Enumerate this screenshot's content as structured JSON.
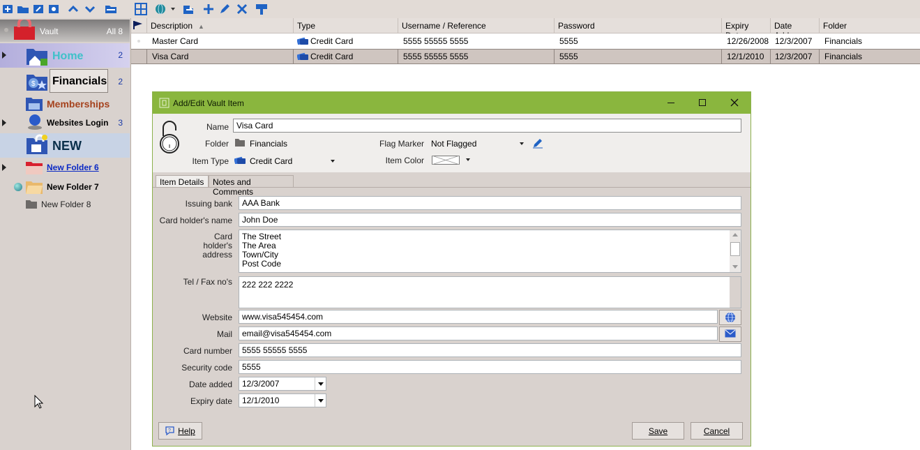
{
  "toolbar": {
    "left_icons": [
      "add-icon",
      "open-folder-icon",
      "edit-folder-icon",
      "settings-folder-icon",
      "move-up-icon",
      "move-down-icon",
      "folder-icon"
    ],
    "right_icons": [
      "grid-view-icon",
      "globe-icon",
      "dropdown-icon",
      "import-icon",
      "add-item-icon",
      "edit-item-icon",
      "delete-item-icon",
      "tree-icon"
    ]
  },
  "tree": {
    "root": {
      "label": "Vault",
      "count": "All 8"
    },
    "items": [
      {
        "label": "Home",
        "count": "2"
      },
      {
        "label": "Financials",
        "count": "2"
      },
      {
        "label": "Memberships",
        "count": ""
      },
      {
        "label": "Websites Login",
        "count": "3"
      },
      {
        "label": "NEW",
        "count": ""
      },
      {
        "label": "New Folder 6",
        "count": ""
      },
      {
        "label": "New Folder 7",
        "count": ""
      },
      {
        "label": "New Folder 8",
        "count": ""
      }
    ]
  },
  "grid": {
    "columns": [
      "Description",
      "Type",
      "Username / Reference",
      "Password",
      "Expiry Date",
      "Date Add...",
      "Folder"
    ],
    "rows": [
      {
        "description": "Master Card",
        "type": "Credit Card",
        "username": "5555 55555 5555",
        "password": "5555",
        "expiry": "12/26/2008",
        "added": "12/3/2007",
        "folder": "Financials"
      },
      {
        "description": "Visa Card",
        "type": "Credit Card",
        "username": "5555 55555 5555",
        "password": "5555",
        "expiry": "12/1/2010",
        "added": "12/3/2007",
        "folder": "Financials"
      }
    ]
  },
  "dialog": {
    "title": "Add/Edit Vault Item",
    "name_label": "Name",
    "name_value": "Visa Card",
    "folder_label": "Folder",
    "folder_value": "Financials",
    "item_type_label": "Item Type",
    "item_type_value": "Credit Card",
    "flag_label": "Flag Marker",
    "flag_value": "Not Flagged",
    "color_label": "Item Color",
    "tabs": [
      "Item Details",
      "Notes and Comments"
    ],
    "fields": {
      "issuing_bank": {
        "label": "Issuing bank",
        "value": "AAA Bank"
      },
      "holder_name": {
        "label": "Card holder's name",
        "value": "John Doe"
      },
      "holder_address": {
        "label1": "Card",
        "label2": "holder's",
        "label3": "address",
        "lines": [
          "The Street",
          "The Area",
          "Town/City",
          "Post Code"
        ]
      },
      "tel": {
        "label": "Tel / Fax no's",
        "value": "222 222 2222"
      },
      "website": {
        "label": "Website",
        "value": "www.visa545454.com"
      },
      "mail": {
        "label": "Mail",
        "value": "email@visa545454.com"
      },
      "card_number": {
        "label": "Card number",
        "value": "5555 55555 5555"
      },
      "security_code": {
        "label": "Security code",
        "value": "5555"
      },
      "date_added": {
        "label": "Date added",
        "value": "12/3/2007"
      },
      "expiry_date": {
        "label": "Expiry date",
        "value": "12/1/2010"
      }
    },
    "help_label": "Help",
    "save_label": "Save",
    "cancel_label": "Cancel"
  },
  "colors": {
    "titlebar": "#8ab63e",
    "pane": "#d9d2ce",
    "selected_row": "#cfc5c0",
    "home_text": "#3fc1c9",
    "memberships_text": "#a5421d",
    "new_text": "#0a2f4a",
    "link_text": "#0b29c4"
  }
}
